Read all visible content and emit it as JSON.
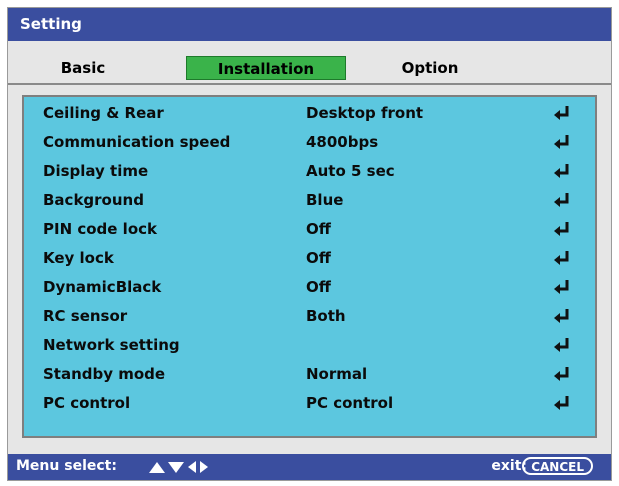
{
  "window": {
    "title": "Setting"
  },
  "tabs": [
    {
      "label": "Basic",
      "active": false
    },
    {
      "label": "Installation",
      "active": true
    },
    {
      "label": "Option",
      "active": false
    }
  ],
  "items": [
    {
      "label": "Ceiling & Rear",
      "value": "Desktop front",
      "icon": "enter-icon"
    },
    {
      "label": "Communication speed",
      "value": "4800bps",
      "icon": "enter-icon"
    },
    {
      "label": "Display time",
      "value": "Auto  5 sec",
      "icon": "enter-icon"
    },
    {
      "label": "Background",
      "value": "Blue",
      "icon": "enter-icon"
    },
    {
      "label": "PIN code lock",
      "value": "Off",
      "icon": "enter-icon"
    },
    {
      "label": "Key lock",
      "value": "Off",
      "icon": "enter-icon"
    },
    {
      "label": "DynamicBlack",
      "value": "Off",
      "icon": "enter-icon"
    },
    {
      "label": "RC sensor",
      "value": "Both",
      "icon": "enter-icon"
    },
    {
      "label": "Network setting",
      "value": "",
      "icon": "enter-icon"
    },
    {
      "label": "Standby mode",
      "value": "Normal",
      "icon": "enter-icon"
    },
    {
      "label": "PC control",
      "value": "PC control",
      "icon": "enter-icon"
    }
  ],
  "statusbar": {
    "menu_select": "Menu select:",
    "exit_label": "exit:",
    "cancel_label": "CANCEL"
  },
  "colors": {
    "title_bar": "#3a4e9f",
    "active_tab": "#3ab34a",
    "panel": "#5cc7df",
    "window": "#e6e6e6"
  }
}
